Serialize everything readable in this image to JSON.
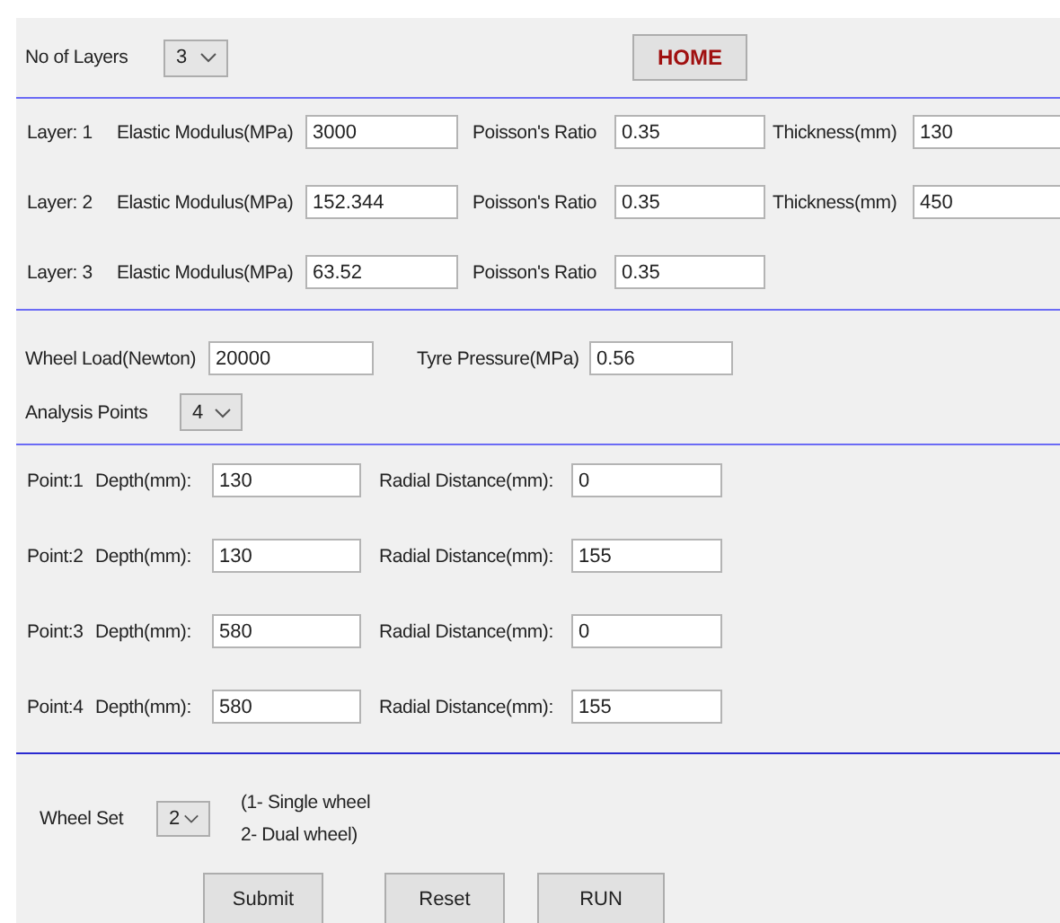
{
  "layers_control": {
    "label": "No of Layers",
    "value": "3"
  },
  "home_button": "HOME",
  "layers": [
    {
      "label": "Layer: 1",
      "modulus_label": "Elastic Modulus(MPa)",
      "modulus": "3000",
      "poisson_label": "Poisson's Ratio",
      "poisson": "0.35",
      "thickness_label": "Thickness(mm)",
      "thickness": "130"
    },
    {
      "label": "Layer: 2",
      "modulus_label": "Elastic Modulus(MPa)",
      "modulus": "152.344",
      "poisson_label": "Poisson's Ratio",
      "poisson": "0.35",
      "thickness_label": "Thickness(mm)",
      "thickness": "450"
    },
    {
      "label": "Layer: 3",
      "modulus_label": "Elastic Modulus(MPa)",
      "modulus": "63.52",
      "poisson_label": "Poisson's Ratio",
      "poisson": "0.35"
    }
  ],
  "load": {
    "wheel_load_label": "Wheel Load(Newton)",
    "wheel_load": "20000",
    "tyre_pressure_label": "Tyre Pressure(MPa)",
    "tyre_pressure": "0.56"
  },
  "analysis_points": {
    "label": "Analysis Points",
    "value": "4"
  },
  "points": [
    {
      "label": "Point:1",
      "depth_label": "Depth(mm):",
      "depth": "130",
      "radial_label": "Radial Distance(mm):",
      "radial": "0"
    },
    {
      "label": "Point:2",
      "depth_label": "Depth(mm):",
      "depth": "130",
      "radial_label": "Radial Distance(mm):",
      "radial": "155"
    },
    {
      "label": "Point:3",
      "depth_label": "Depth(mm):",
      "depth": "580",
      "radial_label": "Radial Distance(mm):",
      "radial": "0"
    },
    {
      "label": "Point:4",
      "depth_label": "Depth(mm):",
      "depth": "580",
      "radial_label": "Radial Distance(mm):",
      "radial": "155"
    }
  ],
  "wheel_set": {
    "label": "Wheel Set",
    "value": "2",
    "note_lines": [
      "(1- Single wheel",
      "2- Dual wheel)"
    ]
  },
  "buttons": [
    "Submit",
    "Reset",
    "RUN"
  ]
}
